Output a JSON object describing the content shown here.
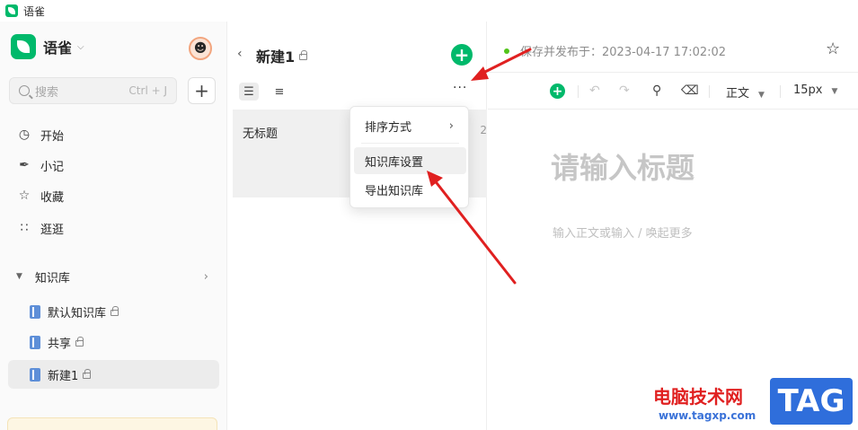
{
  "window": {
    "title": "语雀"
  },
  "sidebar": {
    "brand": "语雀",
    "search": {
      "placeholder": "搜索",
      "shortcut": "Ctrl + J"
    },
    "add_label": "+",
    "nav": [
      {
        "label": "开始",
        "icon": "clock-icon"
      },
      {
        "label": "小记",
        "icon": "feather-icon"
      },
      {
        "label": "收藏",
        "icon": "star-icon"
      },
      {
        "label": "逛逛",
        "icon": "grid-icon"
      }
    ],
    "kb_section": {
      "label": "知识库"
    },
    "kb_items": [
      {
        "label": "默认知识库",
        "locked": true
      },
      {
        "label": "共享",
        "locked": true
      },
      {
        "label": "新建1",
        "locked": true,
        "active": true
      }
    ]
  },
  "middle": {
    "title": "新建1",
    "doc": {
      "title": "无标题",
      "meta": "2"
    }
  },
  "menu": {
    "items": [
      {
        "label": "排序方式",
        "submenu": true
      },
      {
        "label": "知识库设置",
        "hover": true
      },
      {
        "label": "导出知识库"
      }
    ]
  },
  "editor": {
    "status": "保存并发布于：2023-04-17 17:02:02",
    "toolbar": {
      "style_select": "正文",
      "size_select": "15px"
    },
    "title_placeholder": "请输入标题",
    "body_placeholder": "输入正文或输入 / 唤起更多"
  },
  "watermark": {
    "text": "电脑技术网",
    "url": "www.tagxp.com",
    "tag": "TAG"
  },
  "colors": {
    "accent": "#00b96b",
    "arrow": "#e02020"
  }
}
